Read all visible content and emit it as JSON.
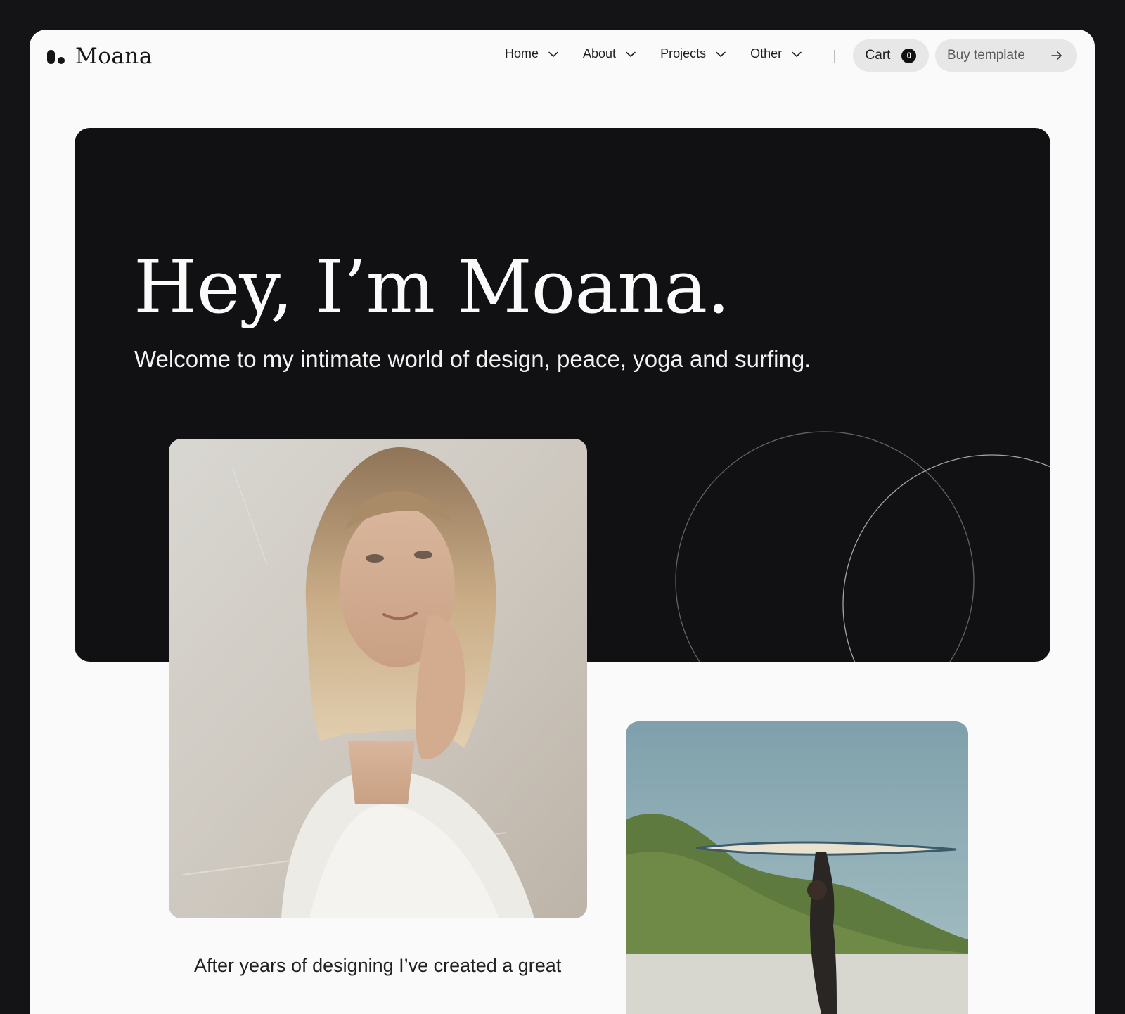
{
  "brand": {
    "name": "Moana"
  },
  "nav": {
    "items": [
      {
        "label": "Home"
      },
      {
        "label": "About"
      },
      {
        "label": "Projects"
      },
      {
        "label": "Other"
      }
    ]
  },
  "cart": {
    "label": "Cart",
    "count": "0"
  },
  "buy": {
    "label": "Buy template"
  },
  "hero": {
    "title": "Hey, I’m Moana.",
    "subtitle": "Welcome to my intimate world of design, peace, yoga and surfing."
  },
  "intro": {
    "text": "After years of designing I’ve created a great"
  },
  "colors": {
    "dark": "#111113",
    "page": "#fafafa",
    "pill": "#e7e7e7"
  },
  "icons": {
    "nav_chevron": "chevron-down-icon",
    "buy_arrow": "arrow-right-icon"
  }
}
